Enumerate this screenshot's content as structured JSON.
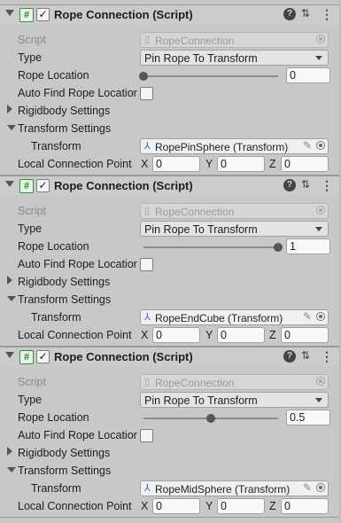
{
  "components": [
    {
      "title": "Rope Connection (Script)",
      "enabled": true,
      "script_label": "Script",
      "script_value": "RopeConnection",
      "type_label": "Type",
      "type_value": "Pin Rope To Transform",
      "rope_location_label": "Rope Location",
      "rope_location_value": "0",
      "rope_location_fraction": 0,
      "auto_find_label": "Auto Find Rope Locatior",
      "auto_find_checked": false,
      "rigidbody_settings_label": "Rigidbody Settings",
      "transform_settings_label": "Transform Settings",
      "transform_label": "Transform",
      "transform_value": "RopePinSphere (Transform)",
      "local_connection_label": "Local Connection Point",
      "x_label": "X",
      "x_value": "0",
      "y_label": "Y",
      "y_value": "0",
      "z_label": "Z",
      "z_value": "0"
    },
    {
      "title": "Rope Connection (Script)",
      "enabled": true,
      "script_label": "Script",
      "script_value": "RopeConnection",
      "type_label": "Type",
      "type_value": "Pin Rope To Transform",
      "rope_location_label": "Rope Location",
      "rope_location_value": "1",
      "rope_location_fraction": 1,
      "auto_find_label": "Auto Find Rope Locatior",
      "auto_find_checked": false,
      "rigidbody_settings_label": "Rigidbody Settings",
      "transform_settings_label": "Transform Settings",
      "transform_label": "Transform",
      "transform_value": "RopeEndCube (Transform)",
      "local_connection_label": "Local Connection Point",
      "x_label": "X",
      "x_value": "0",
      "y_label": "Y",
      "y_value": "0",
      "z_label": "Z",
      "z_value": "0"
    },
    {
      "title": "Rope Connection (Script)",
      "enabled": true,
      "script_label": "Script",
      "script_value": "RopeConnection",
      "type_label": "Type",
      "type_value": "Pin Rope To Transform",
      "rope_location_label": "Rope Location",
      "rope_location_value": "0.5",
      "rope_location_fraction": 0.5,
      "auto_find_label": "Auto Find Rope Locatior",
      "auto_find_checked": false,
      "rigidbody_settings_label": "Rigidbody Settings",
      "transform_settings_label": "Transform Settings",
      "transform_label": "Transform",
      "transform_value": "RopeMidSphere (Transform)",
      "local_connection_label": "Local Connection Point",
      "x_label": "X",
      "x_value": "0",
      "y_label": "Y",
      "y_value": "0",
      "z_label": "Z",
      "z_value": "0"
    }
  ],
  "icons": {
    "foldout": "foldout-arrow-icon",
    "script": "script-icon",
    "help": "help-icon",
    "presets": "presets-icon",
    "menu": "kebab-menu-icon",
    "object_picker": "object-picker-icon",
    "transform": "transform-icon",
    "edit": "pencil-icon"
  }
}
